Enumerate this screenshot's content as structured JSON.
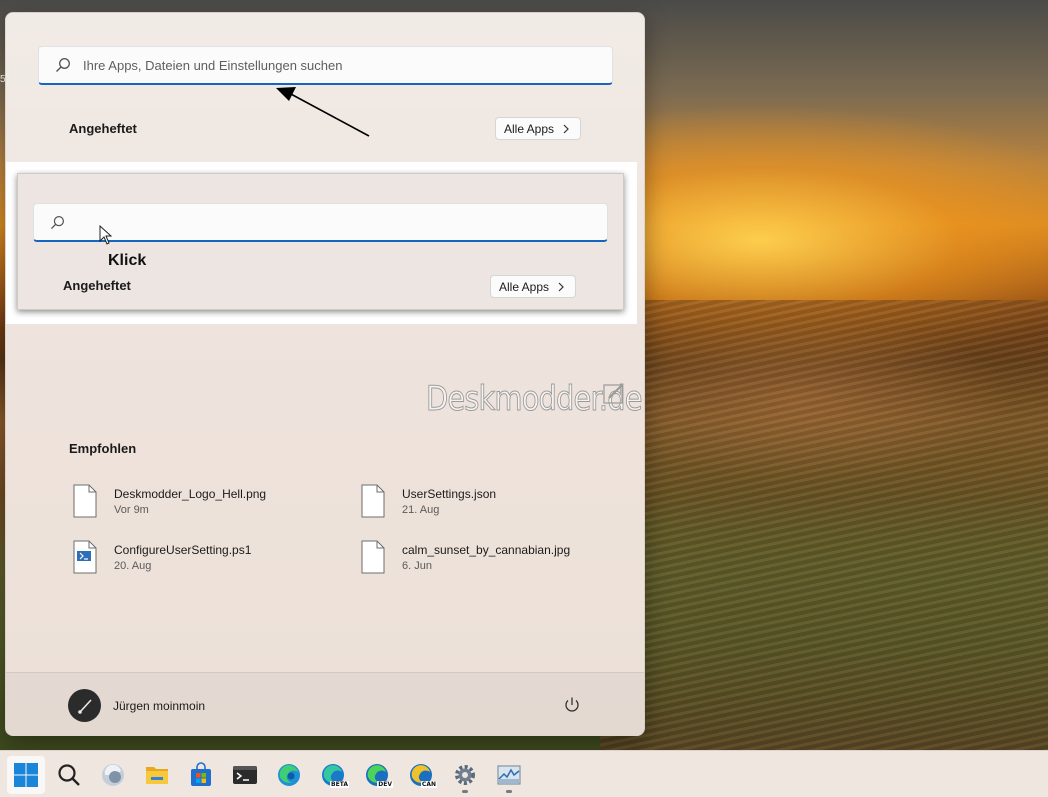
{
  "edge_mark": "5",
  "start_menu": {
    "search": {
      "placeholder": "Ihre Apps, Dateien und Einstellungen suchen"
    },
    "pinned": {
      "title": "Angeheftet",
      "all_apps_label": "Alle Apps"
    },
    "inset": {
      "click_label": "Klick",
      "pinned_title": "Angeheftet",
      "all_apps_label": "Alle Apps"
    },
    "watermark": "Deskmodder.de",
    "recommended": {
      "title": "Empfohlen",
      "items": [
        {
          "name": "Deskmodder_Logo_Hell.png",
          "date": "Vor 9m",
          "icon": "file-icon"
        },
        {
          "name": "UserSettings.json",
          "date": "21. Aug",
          "icon": "file-icon"
        },
        {
          "name": "ConfigureUserSetting.ps1",
          "date": "20. Aug",
          "icon": "powershell-script-icon"
        },
        {
          "name": "calm_sunset_by_cannabian.jpg",
          "date": "6. Jun",
          "icon": "file-icon"
        }
      ]
    },
    "user": {
      "name": "Jürgen moinmoin",
      "avatar_icon": "brush-avatar-icon"
    },
    "power_icon": "power-icon"
  },
  "taskbar": {
    "items": [
      {
        "name": "start",
        "icon": "windows-logo-icon",
        "active": true
      },
      {
        "name": "search",
        "icon": "search-icon"
      },
      {
        "name": "widgets",
        "icon": "widgets-icon"
      },
      {
        "name": "file-explorer",
        "icon": "folder-icon"
      },
      {
        "name": "microsoft-store",
        "icon": "store-icon"
      },
      {
        "name": "terminal",
        "icon": "terminal-icon"
      },
      {
        "name": "edge",
        "icon": "edge-icon"
      },
      {
        "name": "edge-beta",
        "icon": "edge-beta-icon",
        "badge": "BETA"
      },
      {
        "name": "edge-dev",
        "icon": "edge-dev-icon",
        "badge": "DEV"
      },
      {
        "name": "edge-canary",
        "icon": "edge-canary-icon",
        "badge": "CAN"
      },
      {
        "name": "settings",
        "icon": "gear-icon",
        "running": true
      },
      {
        "name": "task-manager",
        "icon": "task-manager-icon",
        "running": true
      }
    ]
  },
  "colors": {
    "accent": "#1566c0",
    "menu_bg": "#eee3dc",
    "taskbar_bg": "#efe6e0"
  }
}
